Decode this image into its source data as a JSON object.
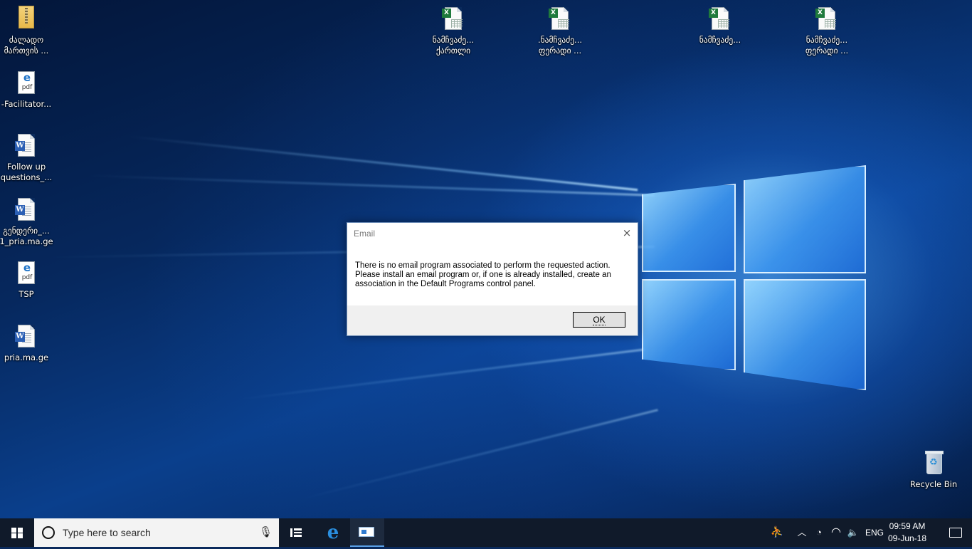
{
  "desktop_icons": [
    {
      "label": "ძალადო\nმართვის ...",
      "type": "zip"
    },
    {
      "label": "-Facilitator...",
      "type": "pdf"
    },
    {
      "label": "Follow up\nquestions_...",
      "type": "word"
    },
    {
      "label": "გენდერი_...\n1_pria.ma.ge",
      "type": "word"
    },
    {
      "label": "TSP",
      "type": "pdf"
    },
    {
      "label": "pria.ma.ge",
      "type": "word"
    },
    {
      "label": "ნამჩვაძე...\nქართლი",
      "type": "excel"
    },
    {
      "label": ".ნამჩვაძე...\nფერადი ...",
      "type": "excel"
    },
    {
      "label": "ნამჩვაძე...",
      "type": "excel"
    },
    {
      "label": "ნამჩვაძე...\nფერადი ...",
      "type": "excel"
    },
    {
      "label": "Recycle Bin",
      "type": "recycle"
    }
  ],
  "pdf_glyph": {
    "e": "e",
    "text": "pdf"
  },
  "word_badge": "W",
  "excel_badge": "X",
  "dialog": {
    "title": "Email",
    "close_icon": "×",
    "message": "There is no email program associated to perform the requested action. Please install an email program or, if one is already installed, create an association in the Default Programs control panel.",
    "ok_label": "OK"
  },
  "taskbar": {
    "search_placeholder": "Type here to search",
    "mic_icon": "🎙",
    "edge_glyph": "e",
    "language": "ENG",
    "time": "09:59 AM",
    "date": "09-Jun-18",
    "tray_people_icon": "⛹",
    "tray_chevron_icon": "︿",
    "tray_network_icon": "◔",
    "tray_wifi_icon": "◠",
    "tray_volume_icon": "🔈"
  }
}
